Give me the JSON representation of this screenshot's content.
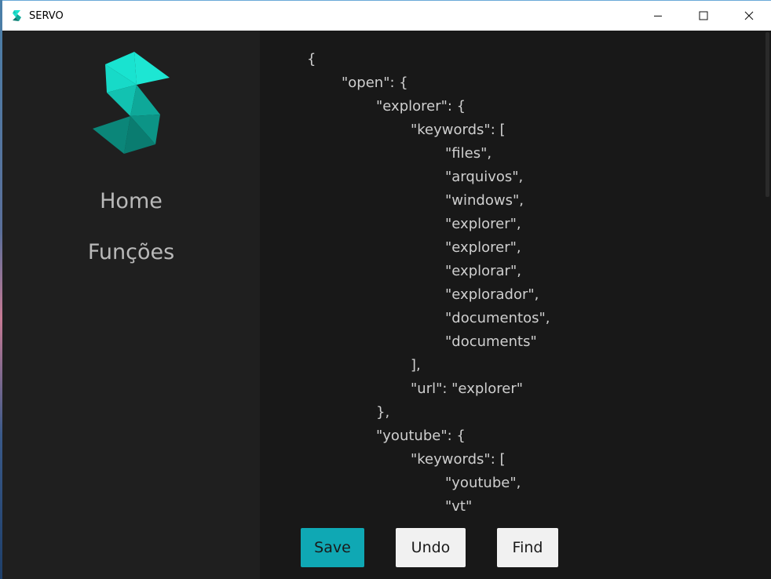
{
  "window": {
    "title": "SERVO",
    "brand_colors": {
      "logo_light": "#19e3d0",
      "logo_mid": "#0ea899",
      "logo_dark": "#0a7c70",
      "accent": "#0fa8b4"
    }
  },
  "sidebar": {
    "nav": [
      {
        "label": "Home"
      },
      {
        "label": "Funções"
      }
    ]
  },
  "editor": {
    "lines": [
      {
        "indent": 0,
        "text": "{"
      },
      {
        "indent": 1,
        "text": "\"open\": {"
      },
      {
        "indent": 2,
        "text": "\"explorer\": {"
      },
      {
        "indent": 3,
        "text": "\"keywords\": ["
      },
      {
        "indent": 4,
        "text": "\"files\","
      },
      {
        "indent": 4,
        "text": "\"arquivos\","
      },
      {
        "indent": 4,
        "text": "\"windows\","
      },
      {
        "indent": 4,
        "text": "\"explorer\","
      },
      {
        "indent": 4,
        "text": "\"explorer\","
      },
      {
        "indent": 4,
        "text": "\"explorar\","
      },
      {
        "indent": 4,
        "text": "\"explorador\","
      },
      {
        "indent": 4,
        "text": "\"documentos\","
      },
      {
        "indent": 4,
        "text": "\"documents\""
      },
      {
        "indent": 3,
        "text": "],"
      },
      {
        "indent": 3,
        "text": "\"url\": \"explorer\""
      },
      {
        "indent": 2,
        "text": "},"
      },
      {
        "indent": 2,
        "text": "\"youtube\": {"
      },
      {
        "indent": 3,
        "text": "\"keywords\": ["
      },
      {
        "indent": 4,
        "text": "\"youtube\","
      },
      {
        "indent": 4,
        "text": "\"vt\""
      }
    ]
  },
  "toolbar": {
    "save_label": "Save",
    "undo_label": "Undo",
    "find_label": "Find"
  },
  "icons": {
    "app": "servo-logo-icon",
    "minimize": "minimize-icon",
    "maximize": "maximize-icon",
    "close": "close-icon"
  }
}
